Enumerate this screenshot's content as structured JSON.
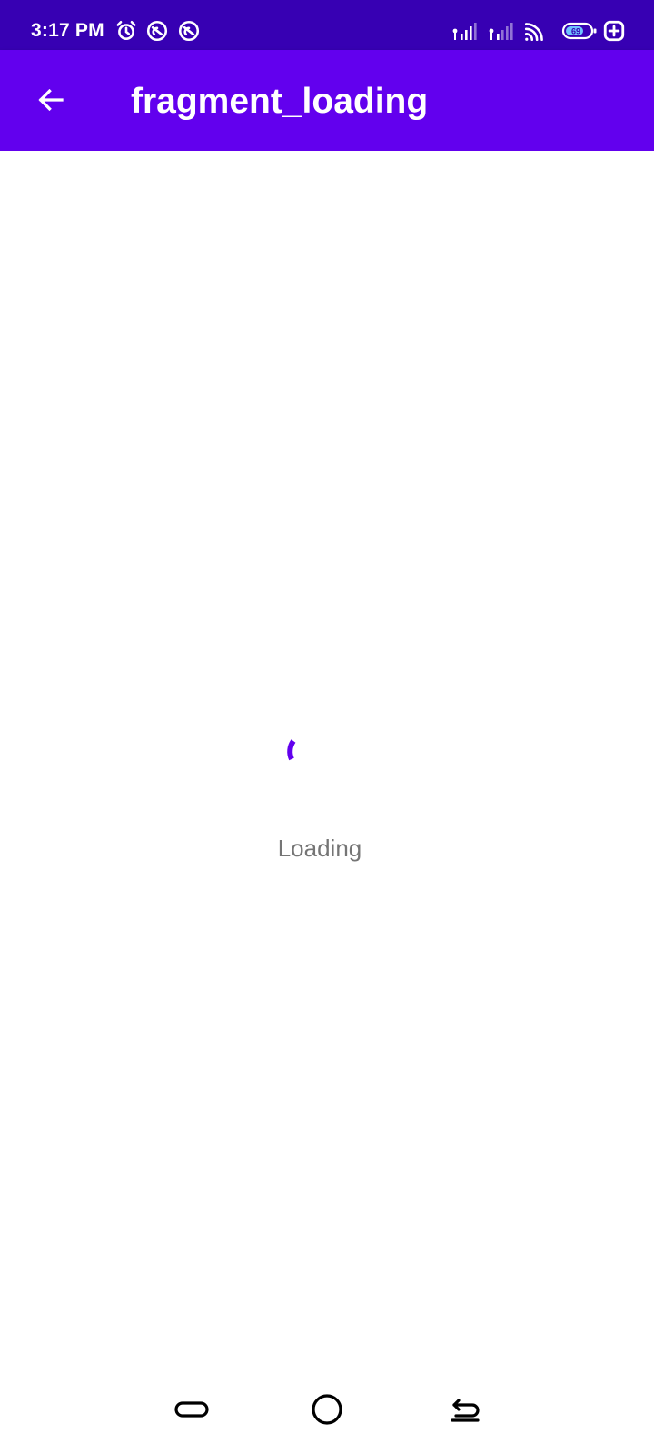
{
  "status_bar": {
    "time": "3:17 PM",
    "battery_level": "69",
    "background_color": "#3700B3",
    "icons": [
      "alarm-icon",
      "sync-icon",
      "sync-icon",
      "signal-icon",
      "signal-icon",
      "wifi-icon",
      "battery-icon",
      "add-icon"
    ]
  },
  "app_bar": {
    "title": "fragment_loading",
    "back_icon": "arrow-back-icon",
    "background_color": "#6200EE"
  },
  "content": {
    "loading_label": "Loading",
    "spinner_color": "#6200EE"
  },
  "nav_bar": {
    "buttons": [
      "recent-apps",
      "home",
      "back"
    ]
  }
}
